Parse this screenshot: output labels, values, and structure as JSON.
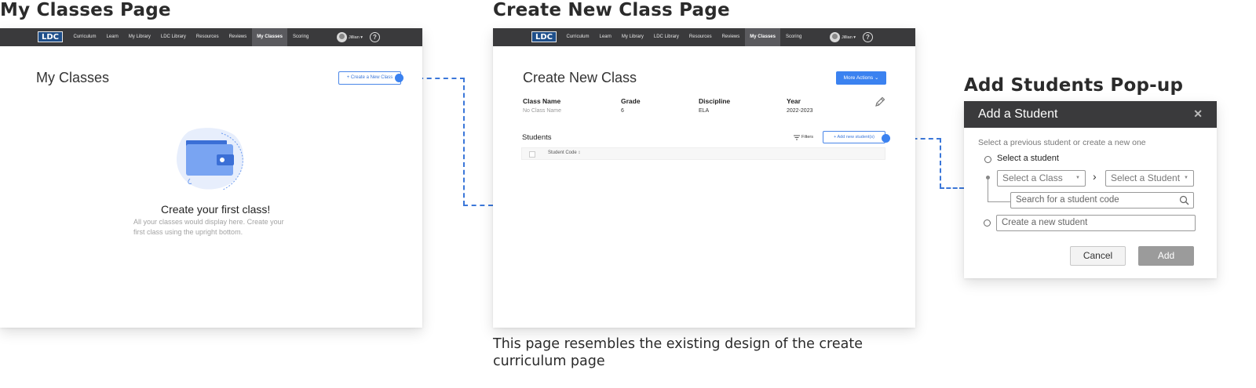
{
  "headings": {
    "my_classes": "My Classes Page",
    "create_class": "Create  New Class Page",
    "add_students": "Add Students Pop-up"
  },
  "nav": {
    "logo": "LDC",
    "items": [
      "Curriculum",
      "Learn",
      "My Library",
      "LDC Library",
      "Resources",
      "Reviews",
      "My Classes",
      "Scoring"
    ],
    "active": "My Classes",
    "user": "Jillian ▾",
    "help": "?"
  },
  "my_classes": {
    "title": "My Classes",
    "create_button": "+ Create a New Class",
    "empty_title": "Create your first class!",
    "empty_description": "All your classes would display here. Create your first class using the upright bottom."
  },
  "create_class": {
    "title": "Create New Class",
    "more_actions": "More Actions  ⌄",
    "fields": [
      {
        "label": "Class Name",
        "value": "No Class Name"
      },
      {
        "label": "Grade",
        "value": "6"
      },
      {
        "label": "Discipline",
        "value": "ELA"
      },
      {
        "label": "Year",
        "value": "2022-2023"
      }
    ],
    "students_label": "Students",
    "filters": "Filters",
    "add_students_button": "+ Add new student(s)",
    "student_code_header": "Student Code ↕"
  },
  "modal": {
    "title": "Add a Student",
    "close": "✕",
    "subtitle": "Select a previous student or create a new one",
    "select_student_label": "Select a student",
    "select_class_placeholder": "Select a Class",
    "select_student_placeholder": "Select a Student",
    "arrow": "›",
    "search_placeholder": "Search for a student code",
    "create_placeholder": "Create a new student",
    "cancel": "Cancel",
    "add": "Add"
  },
  "caption": "This page resembles the existing design of the create curriculum page",
  "colors": {
    "accent": "#3b82f0",
    "nav": "#3a3a3c",
    "illustration": "#6d9cf0"
  }
}
